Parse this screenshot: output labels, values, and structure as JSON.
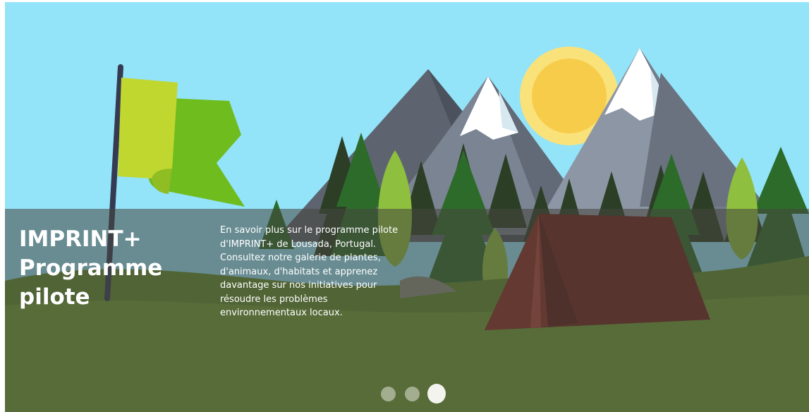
{
  "hero": {
    "title_lines": [
      "IMPRINT+",
      "Programme",
      "pilote"
    ],
    "description": "En savoir plus sur le programme pilote d'IMPRINT+ de Lousada, Portugal. Consultez notre galerie de plantes, d'animaux, d'habitats et apprenez davantage sur nos initiatives pour résoudre les problèmes environnementaux locaux.",
    "illustration_elements": [
      "flag-icon",
      "sun-icon",
      "mountain-icon",
      "pine-tree-icon",
      "tent-icon",
      "grass"
    ]
  },
  "carousel": {
    "slide_count": 3,
    "active_slide": 3
  },
  "colors": {
    "sky": "#93e3f9",
    "overlay": "#46463e",
    "grass": "#4f6b22",
    "flag_light": "#c0d730",
    "flag_dark": "#6fbc1e",
    "tent": "#6d1f1a",
    "sun": "#f9e27a"
  }
}
